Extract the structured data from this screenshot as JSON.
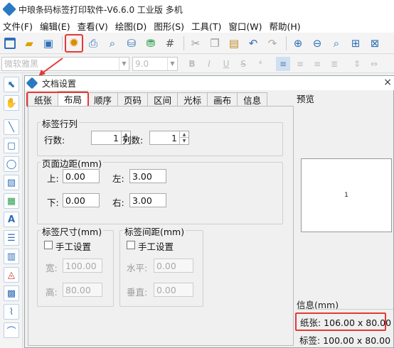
{
  "app": {
    "title": "中琅条码标签打印软件-V6.6.0 工业版 多机"
  },
  "menu": [
    "文件(F)",
    "编辑(E)",
    "查看(V)",
    "绘图(D)",
    "图形(S)",
    "工具(T)",
    "窗口(W)",
    "帮助(H)"
  ],
  "format": {
    "font_name": "微软雅黑",
    "font_size": "9.0"
  },
  "dialog": {
    "title": "文档设置",
    "close_symbol": "×",
    "tabs": [
      "纸张",
      "布局",
      "顺序",
      "页码",
      "区间",
      "光标",
      "画布",
      "信息"
    ],
    "active_tab": "布局",
    "layout": {
      "rows_cols_group": "标签行列",
      "rows_label": "行数:",
      "rows_value": "1",
      "cols_label": "列数:",
      "cols_value": "1",
      "margin_group": "页面边距(mm)",
      "top_label": "上:",
      "top_value": "0.00",
      "left_label": "左:",
      "left_value": "3.00",
      "bottom_label": "下:",
      "bottom_value": "0.00",
      "right_label": "右:",
      "right_value": "3.00",
      "size_group": "标签尺寸(mm)",
      "size_manual": "手工设置",
      "width_label": "宽:",
      "width_value": "100.00",
      "height_label": "高:",
      "height_value": "80.00",
      "gap_group": "标签间距(mm)",
      "gap_manual": "手工设置",
      "hgap_label": "水平:",
      "hgap_value": "0.00",
      "vgap_label": "垂直:",
      "vgap_value": "0.00"
    },
    "preview": {
      "label": "预览",
      "page_number": "1"
    },
    "info": {
      "label": "信息(mm)",
      "paper": "纸张: 106.00 x 80.00",
      "label_size": "标签: 100.00 x 80.00"
    }
  }
}
